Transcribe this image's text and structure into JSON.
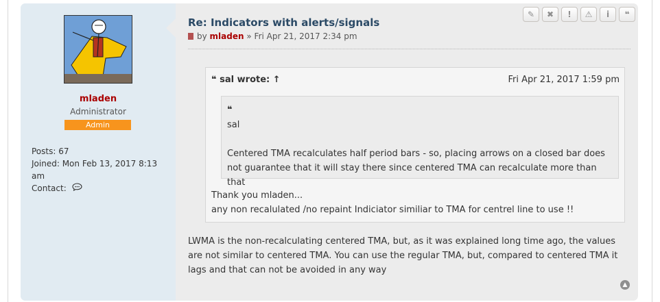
{
  "post": {
    "title": "Re: Indicators with alerts/signals",
    "by_label": "by",
    "author": "mladen",
    "sep": "»",
    "datetime": "Fri Apr 21, 2017 2:34 pm",
    "buttons": [
      {
        "icon": "pencil-icon",
        "glyph": "✎"
      },
      {
        "icon": "close-icon",
        "glyph": "✖"
      },
      {
        "icon": "exclamation-icon",
        "glyph": "!"
      },
      {
        "icon": "warning-icon",
        "glyph": "⚠"
      },
      {
        "icon": "info-icon",
        "glyph": "i"
      },
      {
        "icon": "quote-icon",
        "glyph": "❝"
      }
    ],
    "content": "LWMA is the non-recalculating centered TMA, but, as it was explained long time ago, the values are not similar to centered TMA. You can use the regular TMA, but, compared to centered TMA it lags and that can not be avoided in any way"
  },
  "profile": {
    "username": "mladen",
    "rank": "Administrator",
    "badge": "Admin",
    "posts_label": "Posts:",
    "posts_value": "67",
    "joined_label": "Joined:",
    "joined_value": "Mon Feb 13, 2017 8:13 am",
    "contact_label": "Contact:"
  },
  "quote": {
    "author_line": "sal wrote: ↑",
    "date": "Fri Apr 21, 2017 1:59 pm",
    "inner_mark": "❝",
    "inner_author": "sal",
    "inner_text": "Centered TMA recalculates half period bars - so, placing arrows on a closed bar does not guarantee that it will stay there since centered TMA can recalculate more than that",
    "reply_line1": "Thank you mladen...",
    "reply_line2": "any non recalulated /no repaint Indiciator similiar to TMA for centrel line to use !!"
  },
  "colors": {
    "author_red": "#aa0000",
    "title_blue": "#2b4a66",
    "badge_orange": "#f7941d",
    "profile_bg": "#e1ebf2",
    "post_bg": "#ececec"
  }
}
